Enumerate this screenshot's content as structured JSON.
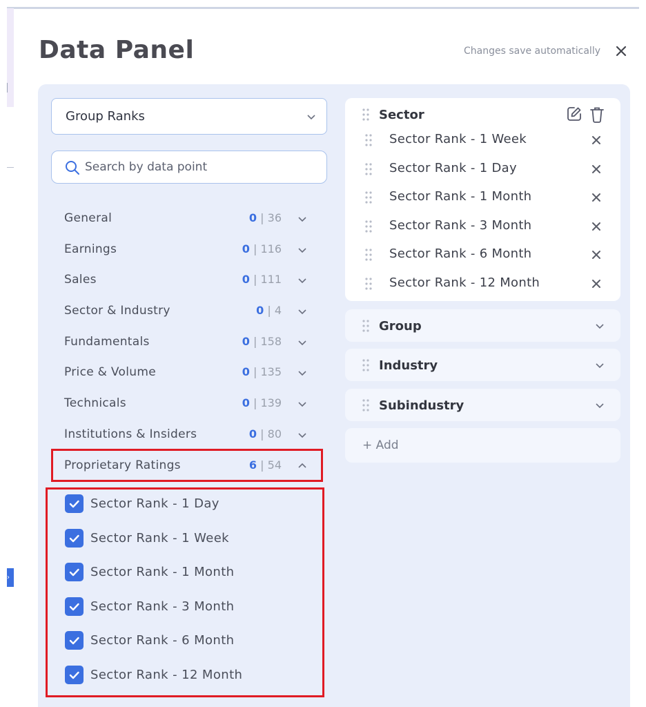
{
  "header": {
    "title": "Data Panel",
    "autosave_note": "Changes save automatically"
  },
  "left": {
    "dropdown_value": "Group Ranks",
    "search_placeholder": "Search by data point",
    "categories": [
      {
        "name": "General",
        "selected": "0",
        "total": "36"
      },
      {
        "name": "Earnings",
        "selected": "0",
        "total": "116"
      },
      {
        "name": "Sales",
        "selected": "0",
        "total": "111"
      },
      {
        "name": "Sector & Industry",
        "selected": "0",
        "total": "4"
      },
      {
        "name": "Fundamentals",
        "selected": "0",
        "total": "158"
      },
      {
        "name": "Price & Volume",
        "selected": "0",
        "total": "135"
      },
      {
        "name": "Technicals",
        "selected": "0",
        "total": "139"
      },
      {
        "name": "Institutions & Insiders",
        "selected": "0",
        "total": "80"
      },
      {
        "name": "Proprietary Ratings",
        "selected": "6",
        "total": "54"
      }
    ],
    "count_separator": "|",
    "options": [
      {
        "label": "Sector Rank - 1 Day",
        "checked": true
      },
      {
        "label": "Sector Rank - 1 Week",
        "checked": true
      },
      {
        "label": "Sector Rank - 1 Month",
        "checked": true
      },
      {
        "label": "Sector Rank - 3 Month",
        "checked": true
      },
      {
        "label": "Sector Rank - 6 Month",
        "checked": true
      },
      {
        "label": "Sector Rank - 12 Month",
        "checked": true
      }
    ]
  },
  "right": {
    "sector": {
      "title": "Sector",
      "items": [
        "Sector Rank - 1 Week",
        "Sector Rank - 1 Day",
        "Sector Rank - 1 Month",
        "Sector Rank - 3 Month",
        "Sector Rank - 6 Month",
        "Sector Rank - 12 Month"
      ]
    },
    "groups": [
      "Group",
      "Industry",
      "Subindustry"
    ],
    "add_label": "+ Add"
  },
  "colors": {
    "accent": "#3b6fe0",
    "highlight": "#e01b24",
    "panel_bg": "#e9eefa"
  }
}
